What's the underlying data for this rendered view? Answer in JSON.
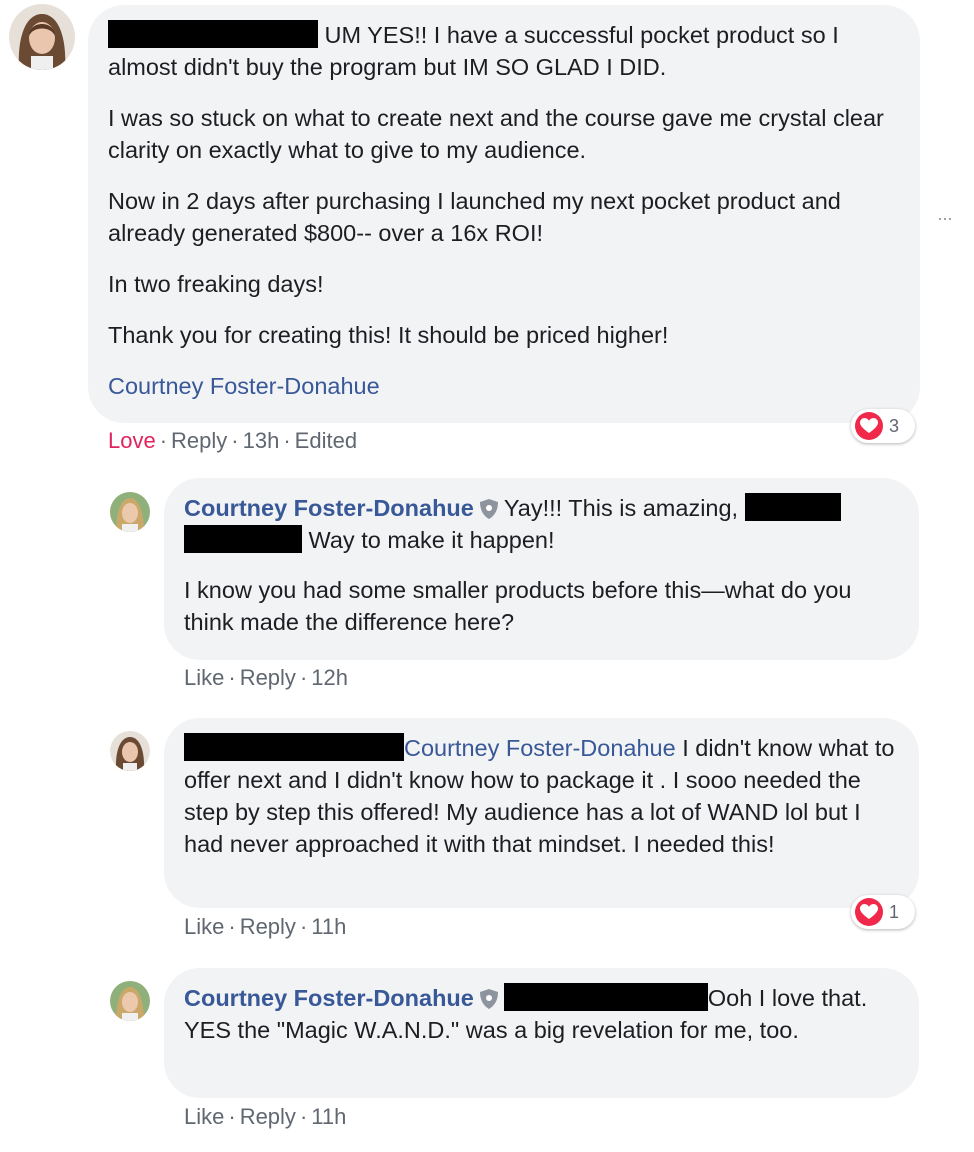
{
  "comments": [
    {
      "paragraphs": {
        "p1": "UM YES!! I have a successful pocket product so I almost didn't buy the program but IM SO GLAD I DID.",
        "p2": "I was so stuck on what to create next and the course gave me crystal clear clarity on exactly what to give to my audience.",
        "p3": "Now in 2 days after purchasing I launched my next pocket product and already generated $800-- over a 16x ROI!",
        "p4": "In two freaking days!",
        "p5": "Thank you for creating this! It should be priced higher!"
      },
      "mention": "Courtney Foster-Donahue",
      "actions": {
        "love": "Love",
        "reply": "Reply",
        "time": "13h",
        "edited": "Edited"
      },
      "reaction_count": "3"
    },
    {
      "author": "Courtney Foster-Donahue",
      "line1": "Yay!!! This is amazing,",
      "line2": "Way to make it happen!",
      "p2": "I know you had some smaller products before this—what do you think made the difference here?",
      "actions": {
        "like": "Like",
        "reply": "Reply",
        "time": "12h"
      }
    },
    {
      "mention": "Courtney Foster-Donahue",
      "body": "I didn't know what to offer next and I didn't know how to package it . I sooo needed the step by step this offered! My audience has a lot of WAND lol but I had never approached it with that mindset. I needed this!",
      "actions": {
        "like": "Like",
        "reply": "Reply",
        "time": "11h"
      },
      "reaction_count": "1"
    },
    {
      "author": "Courtney Foster-Donahue",
      "body_start": "Ooh I love",
      "body_rest": "that. YES the \"Magic W.A.N.D.\" was a big revelation for me, too.",
      "actions": {
        "like": "Like",
        "reply": "Reply",
        "time": "11h"
      }
    }
  ],
  "more_icon": "···",
  "colors": {
    "bubble": "#f2f3f5",
    "link": "#385898",
    "love": "#e0245e",
    "heart": "#f0284a",
    "meta": "#606770"
  }
}
